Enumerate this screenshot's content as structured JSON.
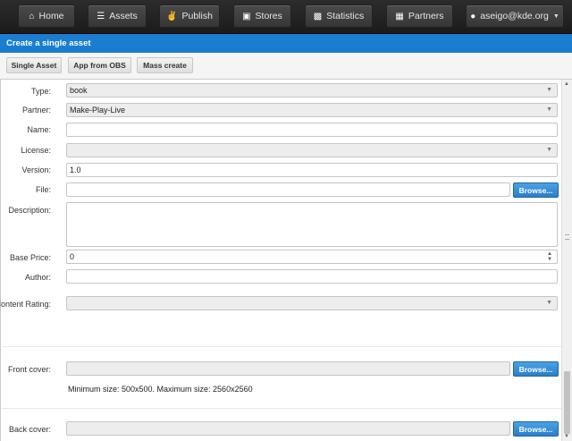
{
  "nav": {
    "items": [
      {
        "label": "Home",
        "icon": "home-icon"
      },
      {
        "label": "Assets",
        "icon": "list-icon"
      },
      {
        "label": "Publish",
        "icon": "thumbs-up-icon"
      },
      {
        "label": "Stores",
        "icon": "cart-icon"
      },
      {
        "label": "Statistics",
        "icon": "bar-chart-icon"
      },
      {
        "label": "Partners",
        "icon": "briefcase-icon"
      }
    ],
    "user": "aseigo@kde.org"
  },
  "header": {
    "title": "Create a single asset"
  },
  "tabs": [
    "Single Asset",
    "App from OBS",
    "Mass create"
  ],
  "form": {
    "type": {
      "label": "Type:",
      "value": "book"
    },
    "partner": {
      "label": "Partner:",
      "value": "Make-Play-Live"
    },
    "name": {
      "label": "Name:",
      "value": ""
    },
    "license": {
      "label": "License:",
      "value": ""
    },
    "version": {
      "label": "Version:",
      "value": "1.0"
    },
    "file": {
      "label": "File:",
      "value": "",
      "button": "Browse..."
    },
    "description": {
      "label": "Description:",
      "value": ""
    },
    "base_price": {
      "label": "Base Price:",
      "value": "0"
    },
    "author": {
      "label": "Author:",
      "value": ""
    },
    "content_rating": {
      "label": "Content Rating:",
      "value": ""
    },
    "front_cover": {
      "label": "Front cover:",
      "button": "Browse...",
      "hint": "Minimum size: 500x500. Maximum size: 2560x2560"
    },
    "back_cover": {
      "label": "Back cover:",
      "button": "Browse..."
    }
  },
  "colors": {
    "header_blue": "#1a7dd0",
    "browse_blue": "#2a7fc8",
    "nav_dark": "#2c2c2c"
  }
}
